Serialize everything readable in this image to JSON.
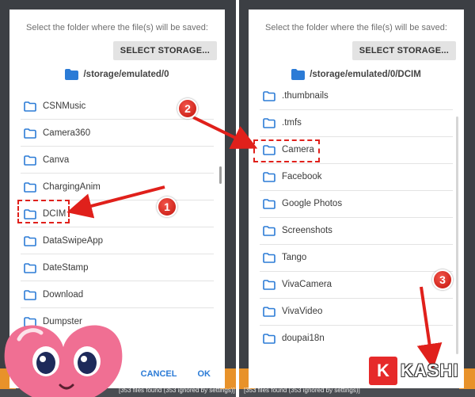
{
  "left_panel": {
    "prompt": "Select the folder where the file(s) will be saved:",
    "storage_button": "SELECT STORAGE...",
    "path": "/storage/emulated/0",
    "folders": [
      "CSNMusic",
      "Camera360",
      "Canva",
      "ChargingAnim",
      "DCIM",
      "DataSwipeApp",
      "DateStamp",
      "Download",
      "Dumpster"
    ],
    "highlighted_folder": "DCIM",
    "cancel_label": "CANCEL",
    "ok_label": "OK",
    "background_text": "[353 files found (353 ignored by settings)]"
  },
  "right_panel": {
    "prompt": "Select the folder where the file(s) will be saved:",
    "storage_button": "SELECT STORAGE...",
    "path": "/storage/emulated/0/DCIM",
    "folders": [
      ".thumbnails",
      ".tmfs",
      "Camera",
      "Facebook",
      "Google Photos",
      "Screenshots",
      "Tango",
      "VivaCamera",
      "VivaVideo",
      "doupai18n"
    ],
    "highlighted_folder": "Camera",
    "background_text": "[353 files found (353 ignored by settings)]"
  },
  "annotations": [
    "1",
    "2",
    "3"
  ],
  "logo": {
    "k": "K",
    "text": "KASHI"
  },
  "colors": {
    "accent": "#2b7bd6",
    "folder": "#2b7bd6",
    "annotation": "#e0201b"
  },
  "icons": {
    "folder": "folder-icon"
  }
}
